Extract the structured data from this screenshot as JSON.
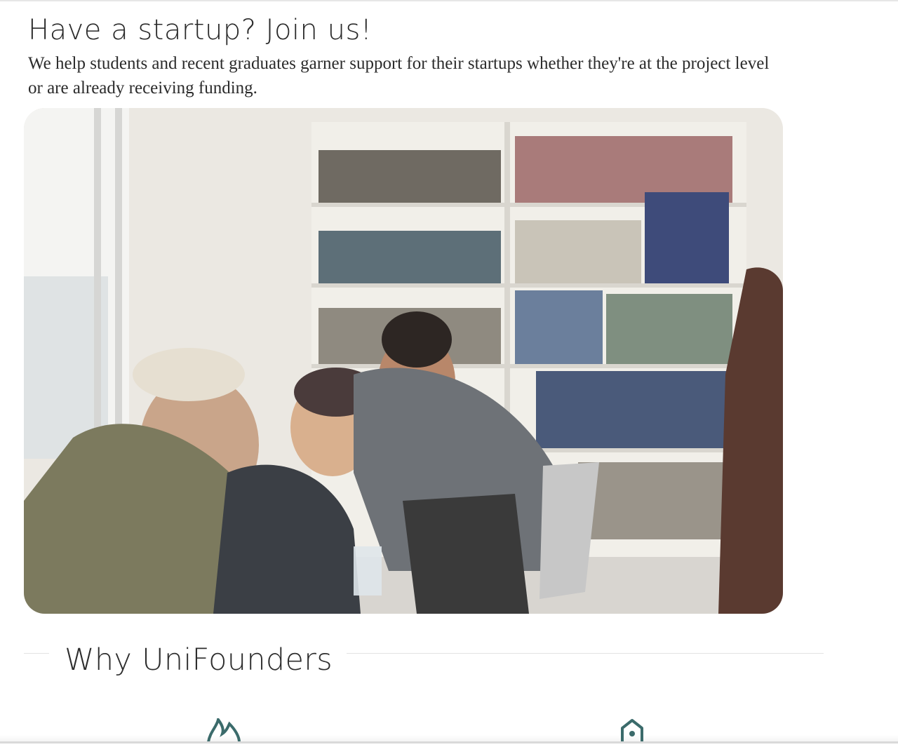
{
  "hero": {
    "title": "Have a startup? Join us!",
    "subtitle": "We help students and recent graduates garner support for their startups whether they're at the project level or are already receiving funding."
  },
  "why": {
    "title": "Why UniFounders"
  },
  "features": [
    {
      "icon": "flame-icon"
    },
    {
      "icon": "house-pin-icon"
    }
  ],
  "colors": {
    "accent": "#3b6b6b",
    "text": "#2a2a2a",
    "divider": "#e3e3e3"
  }
}
